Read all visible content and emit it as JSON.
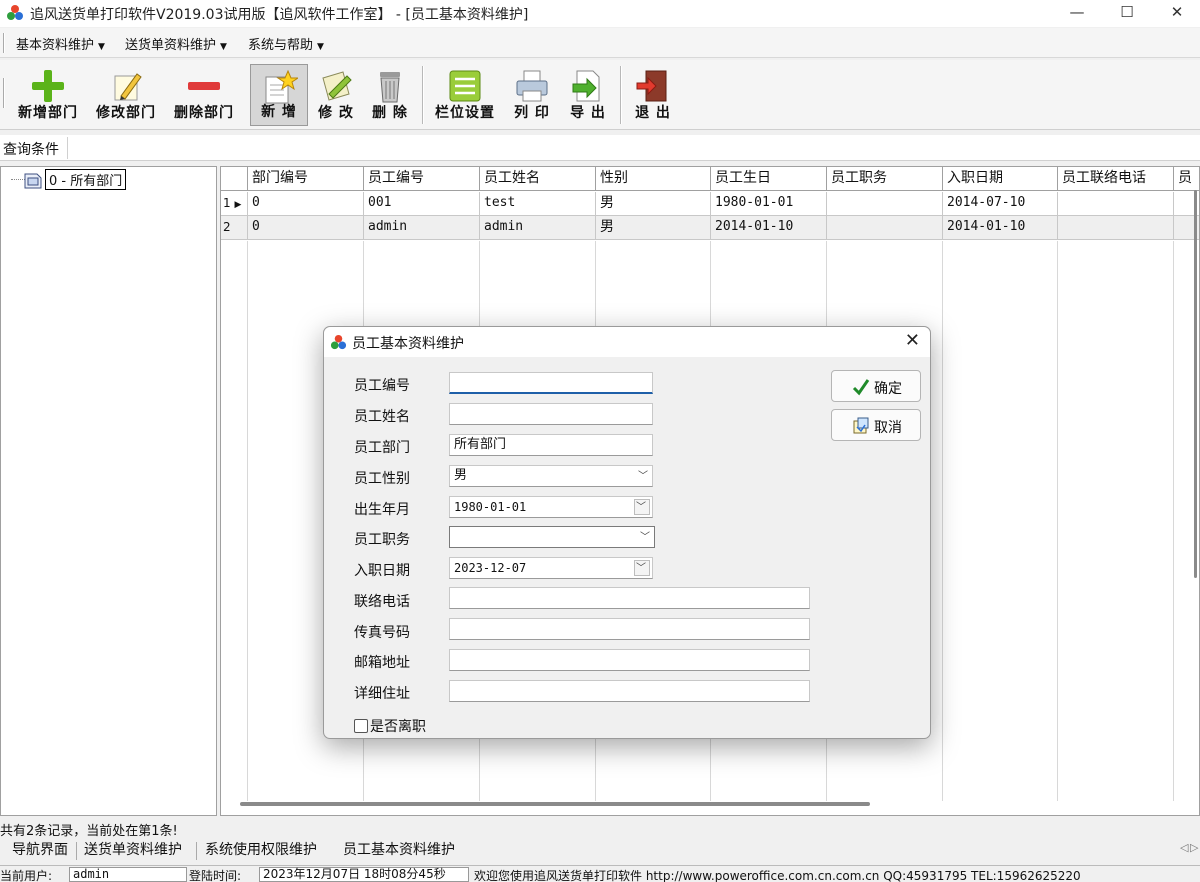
{
  "window": {
    "title": "追风送货单打印软件V2019.03试用版【追风软件工作室】 - [员工基本资料维护]",
    "controls": [
      "—",
      "☐",
      "✕"
    ]
  },
  "menu": {
    "items": [
      "基本资料维护",
      "送货单资料维护",
      "系统与帮助"
    ]
  },
  "toolbar": {
    "add_dept": "新增部门",
    "edit_dept": "修改部门",
    "del_dept": "删除部门",
    "add": "新 增",
    "edit": "修 改",
    "delete": "删 除",
    "columns": "栏位设置",
    "print": "列 印",
    "export": "导 出",
    "exit": "退 出"
  },
  "query": {
    "label": "查询条件"
  },
  "tree": {
    "root": "0 - 所有部门"
  },
  "grid": {
    "columns": [
      "部门编号",
      "员工编号",
      "员工姓名",
      "性别",
      "员工生日",
      "员工职务",
      "入职日期",
      "员工联络电话",
      "员"
    ],
    "rows": [
      {
        "num": "1",
        "cells": [
          "0",
          "001",
          "test",
          "男",
          "1980-01-01",
          "",
          "2014-07-10",
          "",
          ""
        ]
      },
      {
        "num": "2",
        "cells": [
          "0",
          "admin",
          "admin",
          "男",
          "2014-01-10",
          "",
          "2014-01-10",
          "",
          ""
        ]
      }
    ]
  },
  "records": "共有2条记录，当前处在第1条!",
  "tabs": [
    "导航界面",
    "送货单资料维护",
    "系统使用权限维护",
    "员工基本资料维护"
  ],
  "statusbar": {
    "user_label": "当前用户:",
    "user": "admin",
    "login_label": "登陆时间:",
    "login_time": "2023年12月07日 18时08分45秒",
    "welcome": "欢迎您使用追风送货单打印软件 http://www.poweroffice.com.cn.com.cn QQ:45931795 TEL:15962625220"
  },
  "dialog": {
    "title": "员工基本资料维护",
    "fields": {
      "emp_no": {
        "label": "员工编号",
        "value": ""
      },
      "emp_name": {
        "label": "员工姓名",
        "value": ""
      },
      "dept": {
        "label": "员工部门",
        "value": "所有部门"
      },
      "gender": {
        "label": "员工性别",
        "value": "男"
      },
      "birth": {
        "label": "出生年月",
        "value": "1980-01-01"
      },
      "position": {
        "label": "员工职务",
        "value": ""
      },
      "hire": {
        "label": "入职日期",
        "value": "2023-12-07"
      },
      "phone": {
        "label": "联络电话",
        "value": ""
      },
      "fax": {
        "label": "传真号码",
        "value": ""
      },
      "email": {
        "label": "邮箱地址",
        "value": ""
      },
      "address": {
        "label": "详细住址",
        "value": ""
      }
    },
    "resigned_label": "是否离职",
    "ok": "确定",
    "cancel": "取消"
  },
  "icons": {
    "title": "app-cubes-icon",
    "add_dept": "green-plus-icon",
    "edit_dept": "pencil-note-icon",
    "del_dept": "red-minus-icon",
    "add": "star-document-icon",
    "edit": "pencil-paper-icon",
    "delete": "trash-can-icon",
    "columns": "list-icon",
    "print": "printer-icon",
    "export": "export-arrow-icon",
    "exit": "exit-door-icon",
    "ok": "checkmark-icon",
    "cancel": "cancel-document-icon"
  }
}
